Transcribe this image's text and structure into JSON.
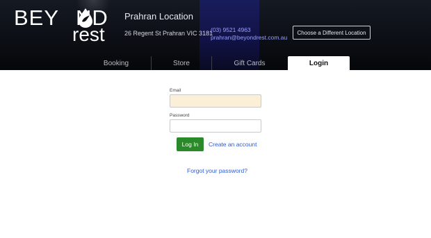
{
  "brand": {
    "line1": "BEY",
    "line1b": "ND",
    "line2": "rest"
  },
  "location": {
    "title": "Prahran Location",
    "address": "26 Regent St Prahran VIC 3181",
    "phone": "(03) 9521 4963",
    "email": "prahran@beyondrest.com.au",
    "choose_label": "Choose a Different Location"
  },
  "tabs": [
    {
      "label": "Booking"
    },
    {
      "label": "Store"
    },
    {
      "label": "Gift Cards"
    },
    {
      "label": "Login"
    }
  ],
  "form": {
    "email_label": "Email",
    "email_value": "",
    "password_label": "Password",
    "password_value": "",
    "login_label": "Log In",
    "create_label": "Create an account",
    "forgot_label": "Forgot your password?"
  },
  "colors": {
    "primary_button": "#2a8a2a",
    "link": "#2a5bd7",
    "autofill": "#fbefd7",
    "header_bg": "#0c0f15"
  }
}
